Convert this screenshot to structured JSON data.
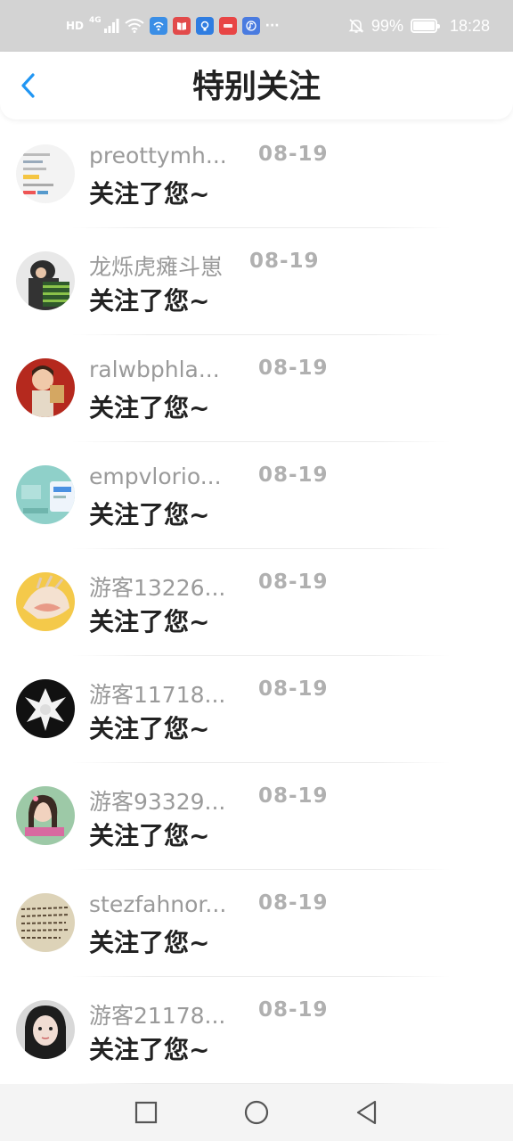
{
  "status_bar": {
    "hd": "HD",
    "net": "4G",
    "battery_percent": "99%",
    "battery_level": 0.99,
    "time": "18:28",
    "more": "···",
    "app_icons": [
      {
        "name": "wifi-app-icon",
        "color": "#3a8ee6"
      },
      {
        "name": "book-app-icon",
        "color": "#e24a4a"
      },
      {
        "name": "bulb-app-icon",
        "color": "#2f7de1"
      },
      {
        "name": "huawei-app-icon",
        "color": "#e84545"
      },
      {
        "name": "music-app-icon",
        "color": "#4a7be0"
      }
    ]
  },
  "header": {
    "title": "特别关注",
    "accent": "#2196f3"
  },
  "items": [
    {
      "name": "preottymh...",
      "date": "08-19",
      "message": "关注了您~"
    },
    {
      "name": "龙烁虎瘫斗崽",
      "date": "08-19",
      "message": "关注了您~"
    },
    {
      "name": "ralwbphla...",
      "date": "08-19",
      "message": "关注了您~"
    },
    {
      "name": "empvlorio...",
      "date": "08-19",
      "message": "关注了您~"
    },
    {
      "name": "游客13226...",
      "date": "08-19",
      "message": "关注了您~"
    },
    {
      "name": "游客11718...",
      "date": "08-19",
      "message": "关注了您~"
    },
    {
      "name": "游客93329...",
      "date": "08-19",
      "message": "关注了您~"
    },
    {
      "name": "stezfahnor...",
      "date": "08-19",
      "message": "关注了您~"
    },
    {
      "name": "游客21178...",
      "date": "08-19",
      "message": "关注了您~"
    }
  ]
}
